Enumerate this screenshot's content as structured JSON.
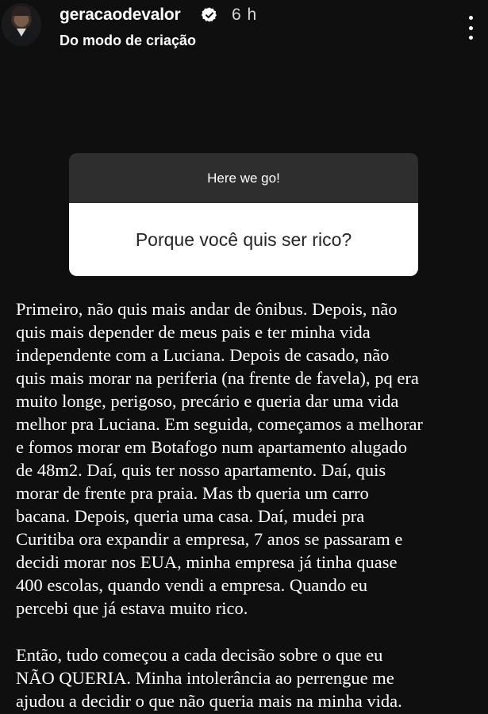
{
  "header": {
    "username": "geracaodevalor",
    "time": "6 h",
    "subtitle": "Do modo de criação",
    "icons": [
      "avatar",
      "verified-badge-icon",
      "more-options-icon"
    ]
  },
  "question_sticker": {
    "prompt": "Here we go!",
    "question": "Porque você quis ser rico?",
    "colors": {
      "header_bg": "#2e2e2e",
      "body_bg": "#ffffff",
      "question_text": "#262626"
    }
  },
  "answer": {
    "paragraph1_lines": [
      "Primeiro, não quis mais andar de ônibus. Depois, não",
      "quis mais depender de meus pais e ter minha vida",
      "independente com a Luciana. Depois de casado, não",
      "quis mais morar na periferia (na frente de favela), pq era",
      "muito longe, perigoso, precário e queria dar uma vida",
      "melhor pra Luciana. Em seguida, começamos a melhorar",
      "e fomos morar em Botafogo num apartamento alugado",
      "de 48m2. Daí, quis ter nosso apartamento. Daí, quis",
      "morar de frente pra praia. Mas tb queria um carro",
      "bacana. Depois, queria uma casa. Daí, mudei pra",
      "Curitiba ora expandir a empresa, 7 anos se passaram e",
      "decidi morar nos EUA, minha empresa já tinha quase",
      "400 escolas, quando vendi a empresa. Quando eu",
      "percebi que já estava muito rico."
    ],
    "paragraph2_lines": [
      "Então, tudo começou a cada decisão sobre  o que eu",
      "NÃO QUERIA. Minha intolerância ao perrengue me",
      "ajudou a decidir o que não queria mais na minha vida."
    ]
  },
  "colors": {
    "background": "#0f0f0f",
    "text": "#ffffff",
    "verified": "#ffffff"
  }
}
